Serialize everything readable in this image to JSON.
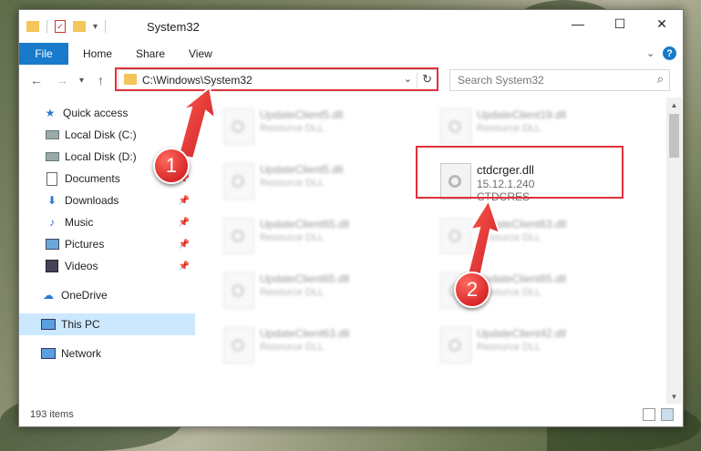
{
  "window": {
    "title": "System32",
    "controls": {
      "minimize": "—",
      "maximize": "☐",
      "close": "✕"
    }
  },
  "ribbon": {
    "tabs": [
      "File",
      "Home",
      "Share",
      "View"
    ]
  },
  "address": {
    "path": "C:\\Windows\\System32",
    "search_placeholder": "Search System32"
  },
  "sidebar": {
    "items": [
      {
        "label": "Quick access",
        "icon": "star-icon",
        "pinned": false
      },
      {
        "label": "Local Disk (C:)",
        "icon": "drive-icon",
        "pinned": false
      },
      {
        "label": "Local Disk (D:)",
        "icon": "drive-icon",
        "pinned": false
      },
      {
        "label": "Documents",
        "icon": "documents-icon",
        "pinned": true
      },
      {
        "label": "Downloads",
        "icon": "download-icon",
        "pinned": true
      },
      {
        "label": "Music",
        "icon": "music-icon",
        "pinned": true
      },
      {
        "label": "Pictures",
        "icon": "pictures-icon",
        "pinned": true
      },
      {
        "label": "Videos",
        "icon": "videos-icon",
        "pinned": true
      },
      {
        "label": "OneDrive",
        "icon": "cloud-icon",
        "pinned": false
      },
      {
        "label": "This PC",
        "icon": "computer-icon",
        "pinned": false,
        "selected": true
      },
      {
        "label": "Network",
        "icon": "network-icon",
        "pinned": false
      }
    ]
  },
  "files": [
    {
      "name": "UpdateClient5.dll",
      "type": "Resource DLL",
      "blurred": true
    },
    {
      "name": "UpdateClient19.dll",
      "type": "Resource DLL",
      "blurred": true
    },
    {
      "name": "UpdateClient5.dll",
      "type": "Resource DLL",
      "blurred": true
    },
    {
      "name": "ctdcrger.dll",
      "version": "15.12.1.240",
      "company": "CTDCRES",
      "blurred": false
    },
    {
      "name": "UpdateClient65.dll",
      "type": "Resource DLL",
      "blurred": true
    },
    {
      "name": "UpdateClient63.dll",
      "type": "Resource DLL",
      "blurred": true
    },
    {
      "name": "UpdateClient65.dll",
      "type": "Resource DLL",
      "blurred": true
    },
    {
      "name": "UpdateClient65.dll",
      "type": "Resource DLL",
      "blurred": true
    },
    {
      "name": "UpdateClient63.dll",
      "type": "Resource DLL",
      "blurred": true
    },
    {
      "name": "UpdateClient42.dll",
      "type": "Resource DLL",
      "blurred": true
    }
  ],
  "status": {
    "item_count": "193 items"
  },
  "callouts": [
    "1",
    "2"
  ],
  "colors": {
    "accent": "#1979ca",
    "highlight": "#e0313a",
    "selected": "#cce8ff"
  }
}
